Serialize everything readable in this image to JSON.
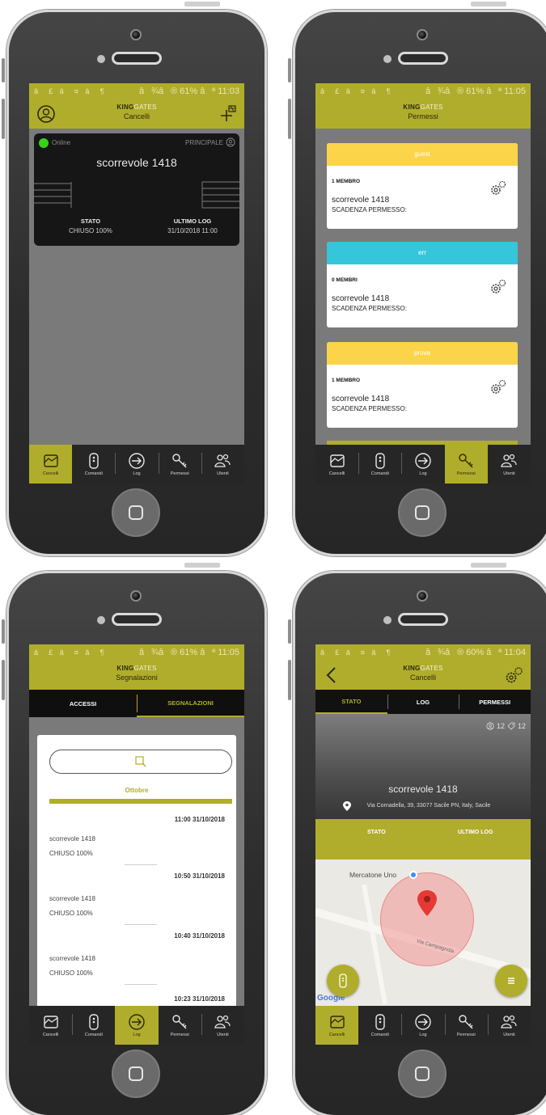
{
  "status_bars": {
    "phone1": "â¾â® 61% âª 11:03",
    "phone2": "â¾â® 61% âª 11:05",
    "phone3": "â¾â® 61% âª 11:05",
    "phone4": "â¾â® 60% âª 11:04",
    "left_icons": "â£ â¤ â¶"
  },
  "brand": {
    "bold": "KING",
    "light": "GATES"
  },
  "tabs": [
    "Cancelli",
    "Comandi",
    "Log",
    "Permessi",
    "Utenti"
  ],
  "phone1": {
    "subtitle": "Cancelli",
    "left_icon": "user-circle-icon",
    "right_icon": "add-gate-icon",
    "gate": {
      "online": "Online",
      "principale": "PRINCIPALE",
      "name": "scorrevole 1418",
      "stato_label": "STATO",
      "stato_value": "CHIUSO 100%",
      "log_label": "ULTIMO LOG",
      "log_value": "31/10/2018 11:00"
    }
  },
  "phone2": {
    "subtitle": "Permessi",
    "cards": [
      {
        "header": "guest",
        "color": "#fbd44a",
        "members": "1 MEMBRO",
        "gate": "scorrevole 1418",
        "expiry": "SCADENZA PERMESSO:"
      },
      {
        "header": "err",
        "color": "#35c6dc",
        "members": "0 MEMBRI",
        "gate": "scorrevole 1418",
        "expiry": "SCADENZA PERMESSO:"
      },
      {
        "header": "prova",
        "color": "#fbd44a",
        "members": "1 MEMBRO",
        "gate": "scorrevole 1418",
        "expiry": "SCADENZA PERMESSO:"
      }
    ]
  },
  "phone3": {
    "subtitle": "Segnalazioni",
    "seg_tabs": [
      "ACCESSI",
      "SEGNALAZIONI"
    ],
    "month": "Ottobre",
    "entries": [
      {
        "time": "11:00 31/10/2018",
        "gate": "scorrevole 1418",
        "state": "CHIUSO 100%"
      },
      {
        "time": "10:50 31/10/2018",
        "gate": "scorrevole 1418",
        "state": "CHIUSO 100%"
      },
      {
        "time": "10:40 31/10/2018",
        "gate": "scorrevole 1418",
        "state": "CHIUSO 100%"
      },
      {
        "time": "10:23 31/10/2018",
        "gate": "",
        "state": ""
      }
    ]
  },
  "phone4": {
    "subtitle": "Cancelli",
    "detail_tabs": [
      "STATO",
      "LOG",
      "PERMESSI"
    ],
    "users_count": "12",
    "keys_count": "12",
    "gate_name": "scorrevole 1418",
    "address": "Via Cornadella, 39, 33077 Sacile PN, Italy, Sacile",
    "info_labels": [
      "STATO",
      "ULTIMO LOG"
    ],
    "map_poi": "Mercatone Uno",
    "map_street": "Via Campagnola",
    "map_logo": "Google"
  },
  "colors": {
    "accent": "#b1ad2c",
    "online": "#37d21a",
    "guest": "#fbd44a",
    "err": "#35c6dc",
    "map_pin": "#e53935"
  }
}
